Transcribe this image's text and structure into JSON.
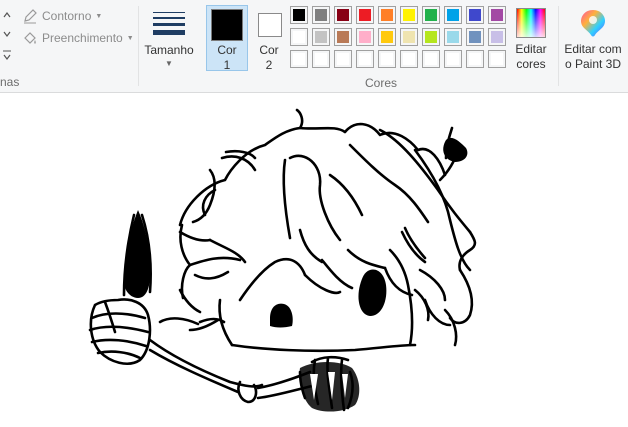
{
  "ribbon": {
    "shapes_group_label": "nas",
    "contorno_label": "Contorno",
    "preenchimento_label": "Preenchimento",
    "tamanho_label": "Tamanho",
    "cor1_label_line1": "Cor",
    "cor1_label_line2": "1",
    "cor2_label_line1": "Cor",
    "cor2_label_line2": "2",
    "cores_group_label": "Cores",
    "editar_cores_line1": "Editar",
    "editar_cores_line2": "cores",
    "paint3d_line1": "Editar com",
    "paint3d_line2": "o Paint 3D"
  },
  "colors": {
    "cor1": "#000000",
    "cor2": "#ffffff",
    "palette_row1": [
      "#000000",
      "#7f7f7f",
      "#880015",
      "#ed1c24",
      "#ff7f27",
      "#fff200",
      "#22b14c",
      "#00a2e8",
      "#3f48cc",
      "#a349a4"
    ],
    "palette_row2": [
      "#ffffff",
      "#c3c3c3",
      "#b97a57",
      "#ffaec9",
      "#ffc90e",
      "#efe4b0",
      "#b5e61d",
      "#99d9ea",
      "#7092be",
      "#c8bfe7"
    ],
    "palette_row3": [
      "#ffffff",
      "#ffffff",
      "#ffffff",
      "#ffffff",
      "#ffffff",
      "#ffffff",
      "#ffffff",
      "#ffffff",
      "#ffffff",
      "#ffffff"
    ]
  },
  "icons": {
    "contorno": "pencil-outline-icon",
    "preenchimento": "paint-bucket-icon",
    "editar_cores": "color-spectrum-icon",
    "paint3d": "paint3d-logo-icon"
  }
}
